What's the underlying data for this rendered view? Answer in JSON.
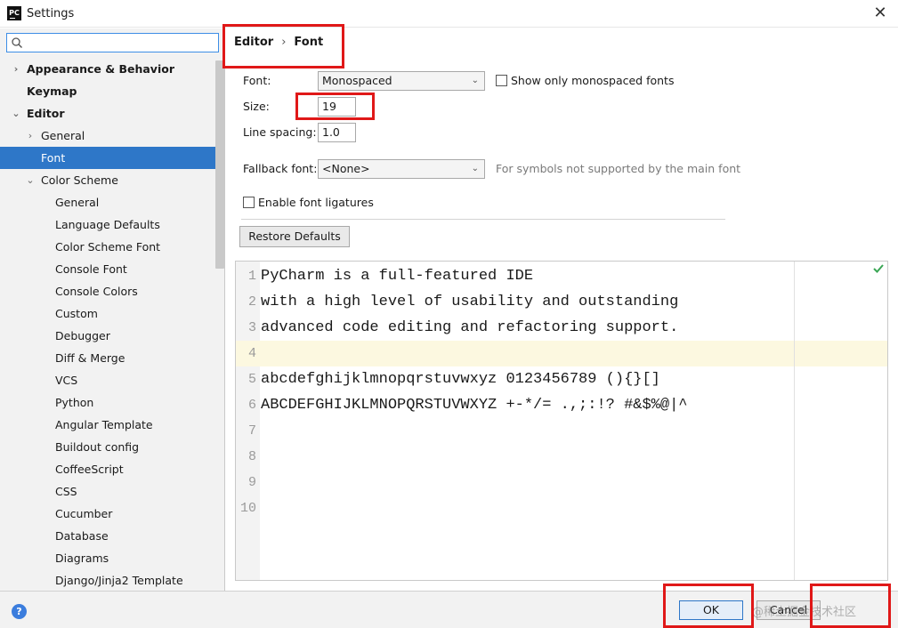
{
  "window": {
    "title": "Settings",
    "app_icon_text": "PC",
    "close_glyph": "✕"
  },
  "sidebar": {
    "search_placeholder": "",
    "items": [
      {
        "label": "Appearance & Behavior"
      },
      {
        "label": "Keymap"
      },
      {
        "label": "Editor"
      },
      {
        "label": "General"
      },
      {
        "label": "Font"
      },
      {
        "label": "Color Scheme"
      },
      {
        "label": "General"
      },
      {
        "label": "Language Defaults"
      },
      {
        "label": "Color Scheme Font"
      },
      {
        "label": "Console Font"
      },
      {
        "label": "Console Colors"
      },
      {
        "label": "Custom"
      },
      {
        "label": "Debugger"
      },
      {
        "label": "Diff & Merge"
      },
      {
        "label": "VCS"
      },
      {
        "label": "Python"
      },
      {
        "label": "Angular Template"
      },
      {
        "label": "Buildout config"
      },
      {
        "label": "CoffeeScript"
      },
      {
        "label": "CSS"
      },
      {
        "label": "Cucumber"
      },
      {
        "label": "Database"
      },
      {
        "label": "Diagrams"
      },
      {
        "label": "Django/Jinja2 Template"
      }
    ]
  },
  "breadcrumb": {
    "parent": "Editor",
    "separator": "›",
    "current": "Font"
  },
  "font_settings": {
    "font_label": "Font:",
    "font_value": "Monospaced",
    "show_mono_label": "Show only monospaced fonts",
    "size_label": "Size:",
    "size_value": "19",
    "line_spacing_label": "Line spacing:",
    "line_spacing_value": "1.0",
    "fallback_label": "Fallback font:",
    "fallback_value": "<None>",
    "fallback_hint": "For symbols not supported by the main font",
    "ligatures_label": "Enable font ligatures",
    "restore_label": "Restore Defaults"
  },
  "preview": {
    "lines": [
      {
        "num": "1",
        "text": "PyCharm is a full-featured IDE"
      },
      {
        "num": "2",
        "text": "with a high level of usability and outstanding"
      },
      {
        "num": "3",
        "text": "advanced code editing and refactoring support."
      },
      {
        "num": "4",
        "text": ""
      },
      {
        "num": "5",
        "text": "abcdefghijklmnopqrstuvwxyz 0123456789 (){}[]"
      },
      {
        "num": "6",
        "text": "ABCDEFGHIJKLMNOPQRSTUVWXYZ +-*/= .,;:!? #&$%@|^"
      },
      {
        "num": "7",
        "text": ""
      },
      {
        "num": "8",
        "text": ""
      },
      {
        "num": "9",
        "text": ""
      },
      {
        "num": "10",
        "text": ""
      }
    ]
  },
  "footer": {
    "help_glyph": "?",
    "ok_label": "OK",
    "cancel_label": "Cancel",
    "watermark": "@稀土掘金技术社区"
  },
  "colors": {
    "selection": "#2e77c8",
    "annotation_red": "#e01818",
    "caret_row": "#fcf8e0"
  }
}
